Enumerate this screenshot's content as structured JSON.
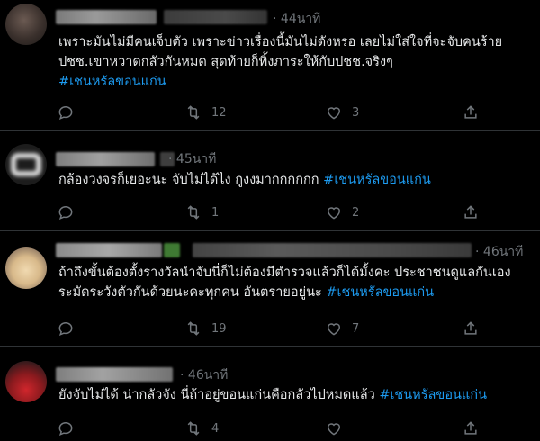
{
  "tweets": [
    {
      "time": "44นาที",
      "lines": [
        "เพราะมันไม่มีคนเจ็บตัว เพราะข่าวเรื่องนี้มันไม่ดังหรอ เลยไม่ใส่ใจที่จะจับคนร้าย",
        "ปชช.เขาหวาดกลัวกันหมด สุดท้ายก็ทิ้งภาระให้กับปชช.จริงๆ"
      ],
      "hashtag": "#เชนหรัลขอนแก่น",
      "retweets": "12",
      "likes": "3"
    },
    {
      "time": "45นาที",
      "text": "กล้องวงจรก็เยอะนะ จับไม่ได้ไง กูงงมากกกกกก",
      "hashtag": "#เชนหรัลขอนแก่น",
      "retweets": "1",
      "likes": "2"
    },
    {
      "time": "46นาที",
      "line1": "ถ้าถึงขั้นต้องตั้งรางวัลนำจับนี่ก็ไม่ต้องมีตำรวจแล้วก็ได้มั้งคะ ประชาชนดูแลกันเอง",
      "line2": "ระมัดระวังตัวกันด้วยนะคะทุกคน อันตรายอยู่นะ",
      "hashtag": "#เชนหรัลขอนแก่น",
      "retweets": "19",
      "likes": "7"
    },
    {
      "time": "46นาที",
      "text": "ยังจับไม่ได้ น่ากลัวจัง นี่ถ้าอยู่ขอนแก่นคือกลัวไปหมดแล้ว",
      "hashtag": "#เชนหรัลขอนแก่น",
      "retweets": "4",
      "likes": ""
    }
  ],
  "colors": {
    "background": "#000000",
    "text": "#e7e9ea",
    "muted": "#71767b",
    "hashtag": "#1d9bf0",
    "divider": "#2f3336"
  },
  "icons": [
    "reply-icon",
    "retweet-icon",
    "like-icon",
    "share-icon"
  ]
}
